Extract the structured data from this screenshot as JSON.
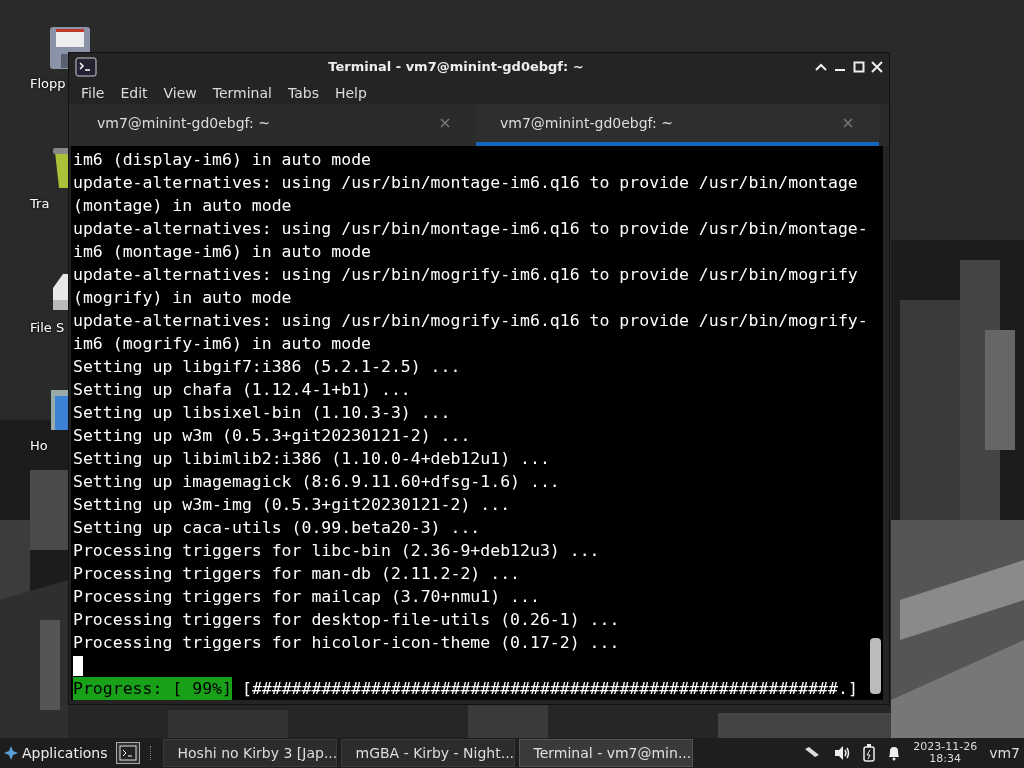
{
  "desktop_icons": [
    {
      "label": "Flopp",
      "kind": "floppy"
    },
    {
      "label": "Tra",
      "kind": "trash"
    },
    {
      "label": "File S",
      "kind": "drive"
    },
    {
      "label": "Ho",
      "kind": "folder"
    }
  ],
  "window": {
    "title": "Terminal - vm7@minint-gd0ebgf: ~"
  },
  "menu": [
    "File",
    "Edit",
    "View",
    "Terminal",
    "Tabs",
    "Help"
  ],
  "tabs": [
    {
      "label": "vm7@minint-gd0ebgf: ~",
      "selected": false
    },
    {
      "label": "vm7@minint-gd0ebgf: ~",
      "selected": true
    }
  ],
  "terminal_lines": [
    "im6 (display-im6) in auto mode",
    "update-alternatives: using /usr/bin/montage-im6.q16 to provide /usr/bin/montage",
    "(montage) in auto mode",
    "update-alternatives: using /usr/bin/montage-im6.q16 to provide /usr/bin/montage-",
    "im6 (montage-im6) in auto mode",
    "update-alternatives: using /usr/bin/mogrify-im6.q16 to provide /usr/bin/mogrify",
    "(mogrify) in auto mode",
    "update-alternatives: using /usr/bin/mogrify-im6.q16 to provide /usr/bin/mogrify-",
    "im6 (mogrify-im6) in auto mode",
    "Setting up libgif7:i386 (5.2.1-2.5) ...",
    "Setting up chafa (1.12.4-1+b1) ...",
    "Setting up libsixel-bin (1.10.3-3) ...",
    "Setting up w3m (0.5.3+git20230121-2) ...",
    "Setting up libimlib2:i386 (1.10.0-4+deb12u1) ...",
    "Setting up imagemagick (8:6.9.11.60+dfsg-1.6) ...",
    "Setting up w3m-img (0.5.3+git20230121-2) ...",
    "Setting up caca-utils (0.99.beta20-3) ...",
    "Processing triggers for libc-bin (2.36-9+deb12u3) ...",
    "Processing triggers for man-db (2.11.2-2) ...",
    "Processing triggers for mailcap (3.70+nmu1) ...",
    "Processing triggers for desktop-file-utils (0.26-1) ...",
    "Processing triggers for hicolor-icon-theme (0.17-2) ..."
  ],
  "progress": {
    "label": "Progress: [ 99%]",
    "bar": "[###########################################################.]"
  },
  "taskbar": {
    "applications": "Applications",
    "tasks": [
      {
        "label": "Hoshi no Kirby 3 [Jap...",
        "kind": "browser",
        "selected": false
      },
      {
        "label": "mGBA - Kirby - Night...",
        "kind": "emulator",
        "selected": false
      },
      {
        "label": "Terminal - vm7@min...",
        "kind": "terminal",
        "selected": true
      }
    ],
    "date": "2023-11-26",
    "time": "18:34",
    "user": "vm7"
  }
}
